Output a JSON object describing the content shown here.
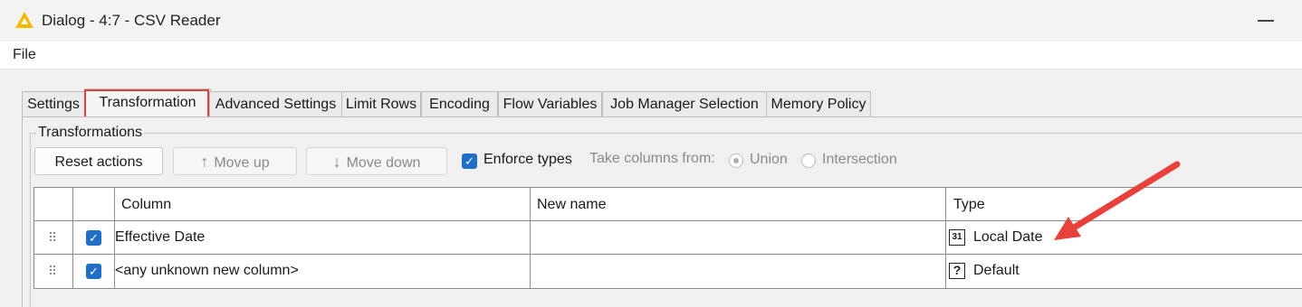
{
  "window": {
    "title": "Dialog - 4:7 - CSV Reader",
    "app_icon": "knime-triangle-icon"
  },
  "menu": {
    "items": [
      "File"
    ]
  },
  "tabs": [
    {
      "label": "Settings"
    },
    {
      "label": "Transformation",
      "active": true,
      "highlighted": true
    },
    {
      "label": "Advanced Settings"
    },
    {
      "label": "Limit Rows"
    },
    {
      "label": "Encoding"
    },
    {
      "label": "Flow Variables"
    },
    {
      "label": "Job Manager Selection"
    },
    {
      "label": "Memory Policy"
    }
  ],
  "group": {
    "title": "Transformations"
  },
  "toolbar": {
    "reset_label": "Reset actions",
    "move_up_label": "Move up",
    "move_down_label": "Move down",
    "enforce_types_label": "Enforce types",
    "enforce_types_checked": true,
    "take_columns_label": "Take columns from:",
    "union_label": "Union",
    "intersection_label": "Intersection",
    "selected_option": "Union"
  },
  "table": {
    "headers": {
      "column": "Column",
      "new_name": "New name",
      "type": "Type"
    },
    "rows": [
      {
        "checked": true,
        "column": "Effective Date",
        "new_name": "",
        "type": "Local Date",
        "type_icon": "calendar-icon",
        "type_icon_text": "31"
      },
      {
        "checked": true,
        "column": "<any unknown new column>",
        "new_name": "",
        "type": "Default",
        "type_icon": "question-icon",
        "type_icon_text": "?"
      }
    ]
  },
  "annotation": {
    "arrow_color": "#e8403a",
    "highlight_color": "#e0413b",
    "accent_color": "#1f6fc9"
  }
}
